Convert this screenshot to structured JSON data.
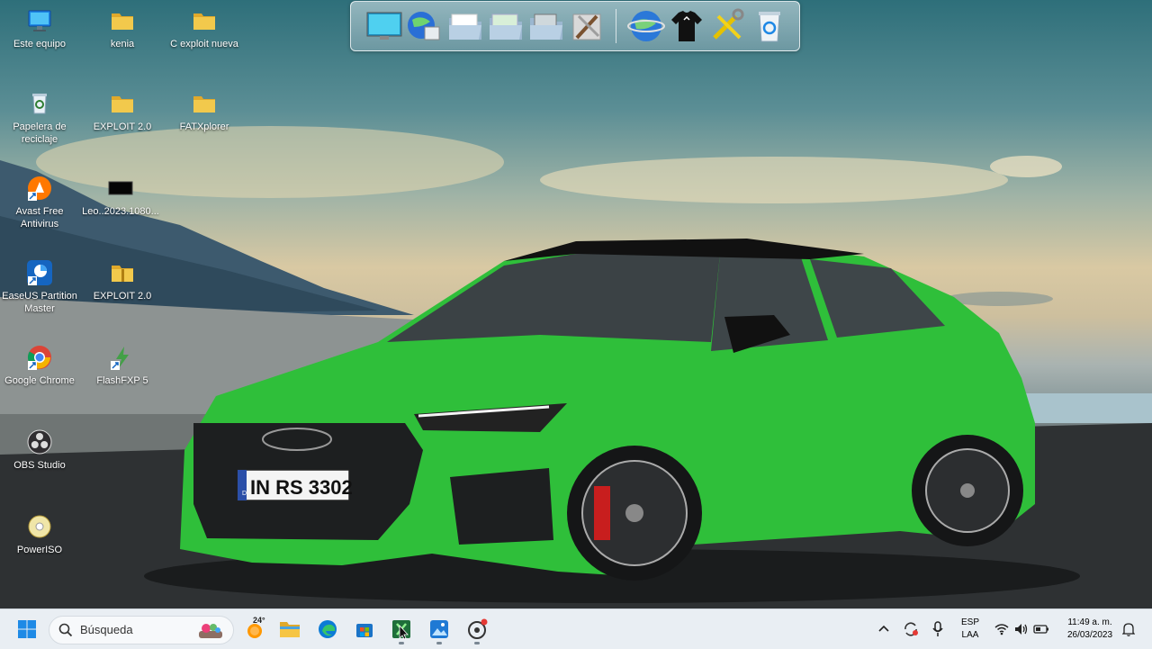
{
  "desktop": {
    "icons": [
      {
        "label": "Este equipo",
        "icon": "computer-icon"
      },
      {
        "label": "kenia",
        "icon": "folder-icon"
      },
      {
        "label": "C exploit nueva",
        "icon": "folder-icon"
      },
      {
        "label": "Papelera de reciclaje",
        "icon": "recycle-bin-icon"
      },
      {
        "label": "EXPLOIT 2.0",
        "icon": "folder-icon"
      },
      {
        "label": "FATXplorer",
        "icon": "folder-icon"
      },
      {
        "label": "Avast Free Antivirus",
        "icon": "avast-icon"
      },
      {
        "label": "Leo..2023.1080...",
        "icon": "video-file-icon"
      },
      {
        "label": "EaseUS Partition Master",
        "icon": "easeus-icon"
      },
      {
        "label": "EXPLOIT 2.0",
        "icon": "zip-folder-icon"
      },
      {
        "label": "Google Chrome",
        "icon": "chrome-icon"
      },
      {
        "label": "FlashFXP 5",
        "icon": "flashfxp-icon"
      },
      {
        "label": "OBS Studio",
        "icon": "obs-icon"
      },
      {
        "label": "PowerISO",
        "icon": "poweriso-icon"
      }
    ],
    "wallpaper_plate": "IN RS 3302",
    "wallpaper_plate_country": "D"
  },
  "dock": {
    "items": [
      "monitor-icon",
      "network-globe-icon",
      "folder-icon",
      "folder-icon",
      "drives-icon",
      "tools-icon",
      "internet-globe-icon",
      "tshirt-icon",
      "settings-tools-icon",
      "recycle-bin-icon"
    ]
  },
  "taskbar": {
    "search_placeholder": "Búsqueda",
    "weather_temp": "24°",
    "apps": [
      "start-icon",
      "weather-icon",
      "file-explorer-icon",
      "edge-icon",
      "store-icon",
      "app-x-icon",
      "photos-icon",
      "recorder-icon"
    ],
    "language_top": "ESP",
    "language_bottom": "LAA",
    "time": "11:49 a. m.",
    "date": "26/03/2023"
  },
  "colors": {
    "taskbar_bg": "#e9eef3",
    "folder_yellow": "#f2c94c",
    "car_green": "#2fbf3a"
  }
}
